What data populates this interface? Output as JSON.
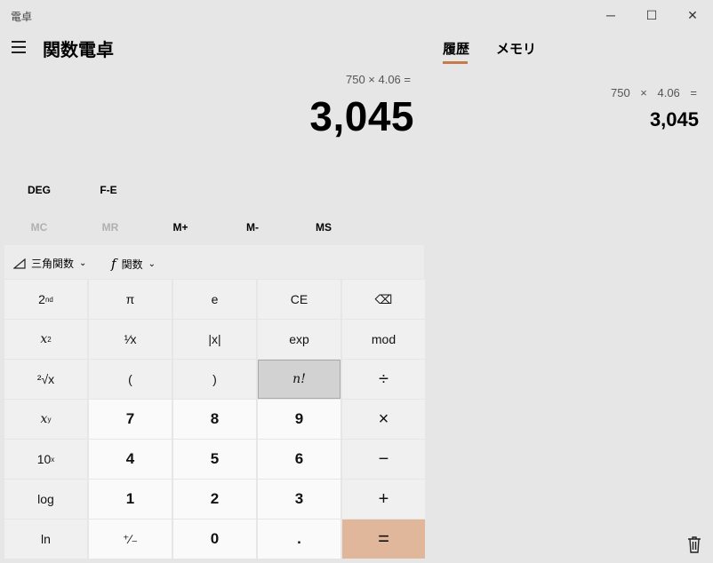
{
  "titlebar": {
    "title": "電卓",
    "minimize": "─",
    "maximize": "☐",
    "close": "✕"
  },
  "header": {
    "mode": "関数電卓"
  },
  "display": {
    "expression": "750 × 4.06 =",
    "result": "3,045"
  },
  "side_panel": {
    "tabs": [
      {
        "label": "履歴"
      },
      {
        "label": "メモリ"
      }
    ],
    "history": [
      {
        "expression": "750 × 4.06 =",
        "result": "3,045"
      }
    ]
  },
  "modes": {
    "angle": "DEG",
    "fe": "F-E"
  },
  "memory": {
    "mc": "MC",
    "mr": "MR",
    "mplus": "M+",
    "mminus": "M-",
    "ms": "MS"
  },
  "functions": {
    "trig": "三角関数",
    "func": "関数",
    "func_symbol": "f"
  },
  "keys": {
    "second": "2",
    "second_sup": "nd",
    "pi": "π",
    "e": "e",
    "ce": "CE",
    "backspace": "⌫",
    "xsq": "x",
    "xsq_sup": "2",
    "recip": "¹⁄x",
    "abs": "|x|",
    "exp": "exp",
    "mod": "mod",
    "sqrt": "²√x",
    "lparen": "(",
    "rparen": ")",
    "fact": "n!",
    "divide": "÷",
    "xpow": "x",
    "xpow_sup": "y",
    "n7": "7",
    "n8": "8",
    "n9": "9",
    "multiply": "×",
    "tenpow": "10",
    "tenpow_sup": "x",
    "n4": "4",
    "n5": "5",
    "n6": "6",
    "minus": "−",
    "log": "log",
    "n1": "1",
    "n2": "2",
    "n3": "3",
    "plus": "+",
    "ln": "ln",
    "negate": "⁺∕₋",
    "n0": "0",
    "decimal": ".",
    "equals": "="
  },
  "colors": {
    "accent": "#c97a4a",
    "equals_bg": "#e0b79b",
    "background": "#e6e6e6"
  },
  "icons": {
    "trash": "trash-icon",
    "hamburger": "hamburger-icon",
    "triangle": "triangle-icon"
  }
}
